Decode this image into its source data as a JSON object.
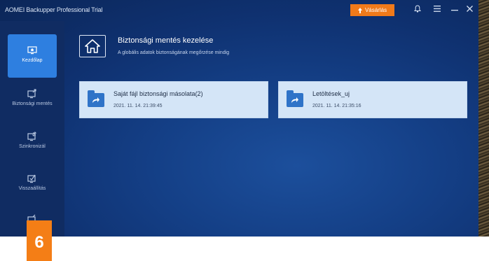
{
  "window": {
    "title": "AOMEI Backupper Professional Trial",
    "upgrade_label": "Vásárlás"
  },
  "sidebar": {
    "items": [
      {
        "label": "Kezdőlap",
        "icon": "home-monitor-icon",
        "active": true
      },
      {
        "label": "Biztonsági mentés",
        "icon": "backup-icon",
        "active": false
      },
      {
        "label": "Szinkronizál",
        "icon": "sync-icon",
        "active": false
      },
      {
        "label": "Visszaállítás",
        "icon": "restore-icon",
        "active": false
      },
      {
        "label": "",
        "icon": "more-icon",
        "active": false
      }
    ]
  },
  "main": {
    "heading": "Biztonsági mentés kezelése",
    "subheading": "A globális adatok biztonságának megőrzése mindig",
    "backups": [
      {
        "name": "Saját fájl biztonsági másolata(2)",
        "date": "2021. 11. 14. 21:39:45"
      },
      {
        "name": "Letöltések_uj",
        "date": "2021. 11. 14. 21:35:16"
      }
    ]
  },
  "step_badge": "6",
  "colors": {
    "accent": "#2e7fe0",
    "upgrade": "#f07a1a",
    "card": "#d4e5f7",
    "badge": "#f47e16"
  }
}
